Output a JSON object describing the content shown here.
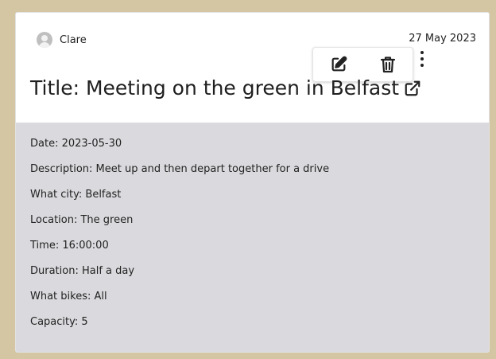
{
  "post": {
    "author": "Clare",
    "date": "27 May 2023",
    "title": "Title: Meeting on the green in Belfast"
  },
  "icons": {
    "avatar": "user-avatar-icon",
    "edit": "edit-icon",
    "delete": "trash-icon",
    "menu": "more-vertical-icon",
    "external": "external-link-icon"
  },
  "details": [
    {
      "text": "Date: 2023-05-30"
    },
    {
      "text": "Description: Meet up and then depart together for a drive"
    },
    {
      "text": "What city: Belfast"
    },
    {
      "text": "Location: The green"
    },
    {
      "text": "Time: 16:00:00"
    },
    {
      "text": "Duration: Half a day"
    },
    {
      "text": "What bikes: All"
    },
    {
      "text": "Capacity: 5"
    }
  ],
  "colors": {
    "page_background": "#d4c5a3",
    "card": "#ffffff",
    "details_background": "#dadade",
    "text": "#222222"
  }
}
